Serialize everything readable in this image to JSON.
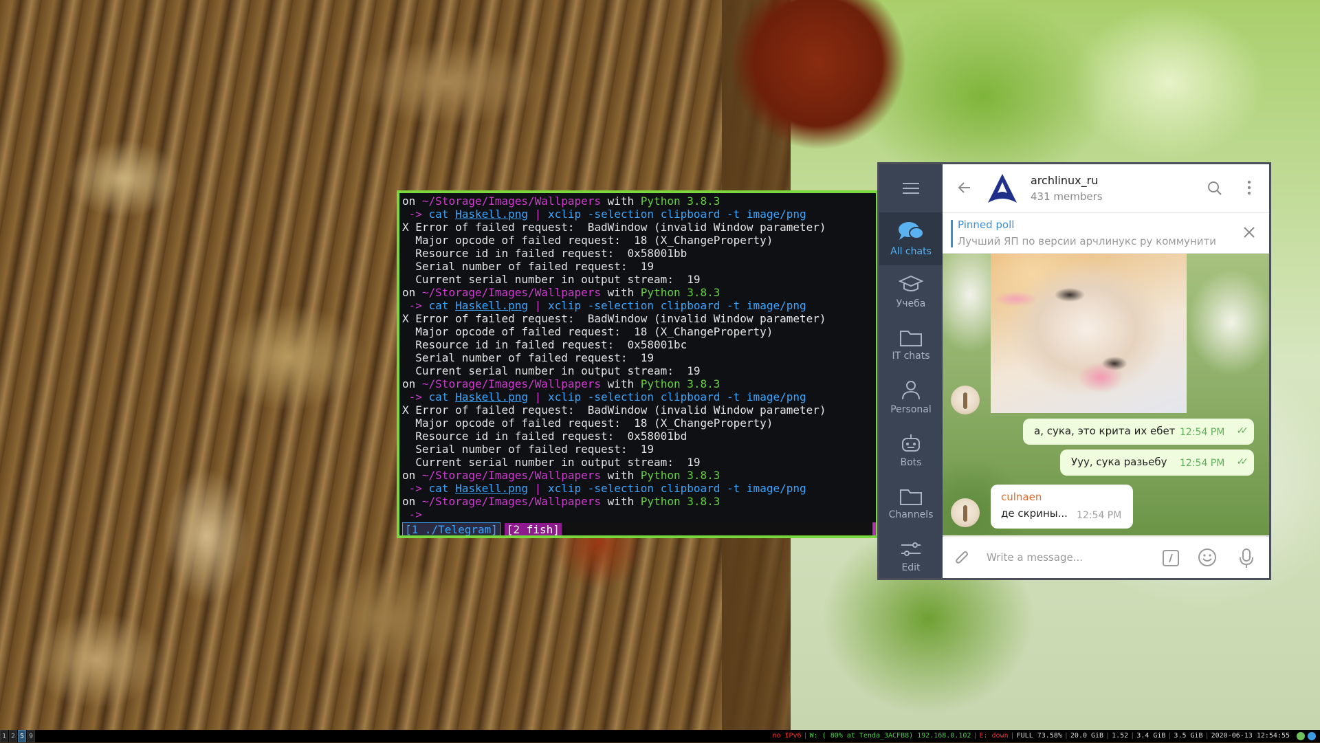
{
  "terminal": {
    "lines": [
      [
        {
          "t": "on ",
          "c": ""
        },
        {
          "t": "~/Storage/Images/Wallpapers",
          "c": "c-path"
        },
        {
          "t": " with ",
          "c": ""
        },
        {
          "t": "Python 3.8.3",
          "c": "c-py"
        }
      ],
      [
        {
          "t": " -> ",
          "c": "c-arrow"
        },
        {
          "t": "cat ",
          "c": "c-cmd"
        },
        {
          "t": "Haskell.png",
          "c": "c-file"
        },
        {
          "t": " | ",
          "c": "c-pipe"
        },
        {
          "t": "xclip -selection clipboard -t image/png",
          "c": "c-cmd"
        }
      ],
      [
        {
          "t": "X Error of failed request:  BadWindow (invalid Window parameter)",
          "c": ""
        }
      ],
      [
        {
          "t": "  Major opcode of failed request:  18 (X_ChangeProperty)",
          "c": ""
        }
      ],
      [
        {
          "t": "  Resource id in failed request:  0x58001bb",
          "c": ""
        }
      ],
      [
        {
          "t": "  Serial number of failed request:  19",
          "c": ""
        }
      ],
      [
        {
          "t": "  Current serial number in output stream:  19",
          "c": ""
        }
      ],
      [
        {
          "t": "on ",
          "c": ""
        },
        {
          "t": "~/Storage/Images/Wallpapers",
          "c": "c-path"
        },
        {
          "t": " with ",
          "c": ""
        },
        {
          "t": "Python 3.8.3",
          "c": "c-py"
        }
      ],
      [
        {
          "t": " -> ",
          "c": "c-arrow"
        },
        {
          "t": "cat ",
          "c": "c-cmd"
        },
        {
          "t": "Haskell.png",
          "c": "c-file"
        },
        {
          "t": " | ",
          "c": "c-pipe"
        },
        {
          "t": "xclip -selection clipboard -t image/png",
          "c": "c-cmd"
        }
      ],
      [
        {
          "t": "X Error of failed request:  BadWindow (invalid Window parameter)",
          "c": ""
        }
      ],
      [
        {
          "t": "  Major opcode of failed request:  18 (X_ChangeProperty)",
          "c": ""
        }
      ],
      [
        {
          "t": "  Resource id in failed request:  0x58001bc",
          "c": ""
        }
      ],
      [
        {
          "t": "  Serial number of failed request:  19",
          "c": ""
        }
      ],
      [
        {
          "t": "  Current serial number in output stream:  19",
          "c": ""
        }
      ],
      [
        {
          "t": "on ",
          "c": ""
        },
        {
          "t": "~/Storage/Images/Wallpapers",
          "c": "c-path"
        },
        {
          "t": " with ",
          "c": ""
        },
        {
          "t": "Python 3.8.3",
          "c": "c-py"
        }
      ],
      [
        {
          "t": " -> ",
          "c": "c-arrow"
        },
        {
          "t": "cat ",
          "c": "c-cmd"
        },
        {
          "t": "Haskell.png",
          "c": "c-file"
        },
        {
          "t": " | ",
          "c": "c-pipe"
        },
        {
          "t": "xclip -selection clipboard -t image/png",
          "c": "c-cmd"
        }
      ],
      [
        {
          "t": "X Error of failed request:  BadWindow (invalid Window parameter)",
          "c": ""
        }
      ],
      [
        {
          "t": "  Major opcode of failed request:  18 (X_ChangeProperty)",
          "c": ""
        }
      ],
      [
        {
          "t": "  Resource id in failed request:  0x58001bd",
          "c": ""
        }
      ],
      [
        {
          "t": "  Serial number of failed request:  19",
          "c": ""
        }
      ],
      [
        {
          "t": "  Current serial number in output stream:  19",
          "c": ""
        }
      ],
      [
        {
          "t": "on ",
          "c": ""
        },
        {
          "t": "~/Storage/Images/Wallpapers",
          "c": "c-path"
        },
        {
          "t": " with ",
          "c": ""
        },
        {
          "t": "Python 3.8.3",
          "c": "c-py"
        }
      ],
      [
        {
          "t": " -> ",
          "c": "c-arrow"
        },
        {
          "t": "cat ",
          "c": "c-cmd"
        },
        {
          "t": "Haskell.png",
          "c": "c-file"
        },
        {
          "t": " | ",
          "c": "c-pipe"
        },
        {
          "t": "xclip -selection clipboard -t image/png",
          "c": "c-cmd"
        }
      ],
      [
        {
          "t": "on ",
          "c": ""
        },
        {
          "t": "~/Storage/Images/Wallpapers",
          "c": "c-path"
        },
        {
          "t": " with ",
          "c": ""
        },
        {
          "t": "Python 3.8.3",
          "c": "c-py"
        }
      ],
      [
        {
          "t": " ->",
          "c": "c-arrow"
        }
      ]
    ],
    "tabs": [
      "[1 ./Telegram]",
      "[2 fish]"
    ]
  },
  "telegram": {
    "folders": [
      {
        "label": "All chats",
        "icon": "chat-bubbles-icon",
        "active": true
      },
      {
        "label": "Учеба",
        "icon": "graduation-cap-icon",
        "active": false
      },
      {
        "label": "IT chats",
        "icon": "folder-icon",
        "active": false
      },
      {
        "label": "Personal",
        "icon": "person-icon",
        "active": false
      },
      {
        "label": "Bots",
        "icon": "robot-icon",
        "active": false
      },
      {
        "label": "Channels",
        "icon": "folder-icon",
        "active": false
      },
      {
        "label": "Edit",
        "icon": "sliders-icon",
        "active": false
      }
    ],
    "header": {
      "title": "archlinux_ru",
      "subtitle": "431 members"
    },
    "pinned": {
      "label": "Pinned poll",
      "text": "Лучший ЯП по версии арчлинукс ру коммунити"
    },
    "messages": [
      {
        "text": "а, сука, это крита их ебет",
        "time": "12:54 PM",
        "outgoing": true
      },
      {
        "text": "Ууу, сука разьебу",
        "time": "12:54 PM",
        "outgoing": true
      },
      {
        "sender": "culnaen",
        "text": "де скрины...",
        "time": "12:54 PM",
        "outgoing": false
      }
    ],
    "input": {
      "placeholder": "Write a message..."
    },
    "accent": "#3a90d0"
  },
  "statusbar": {
    "workspaces": [
      {
        "n": "1",
        "active": false
      },
      {
        "n": "2",
        "active": false
      },
      {
        "n": "5",
        "active": true
      },
      {
        "n": "9",
        "active": false
      }
    ],
    "blocks": [
      {
        "t": "no IPv6",
        "c": "st-red"
      },
      {
        "t": "W: ( 80% at Tenda_3ACFB8) 192.168.0.102",
        "c": "st-green"
      },
      {
        "t": "E: down",
        "c": "st-red"
      },
      {
        "t": "FULL 73.58%",
        "c": ""
      },
      {
        "t": "20.0 GiB",
        "c": ""
      },
      {
        "t": "1.52",
        "c": ""
      },
      {
        "t": "3.4 GiB",
        "c": ""
      },
      {
        "t": "3.5 GiB",
        "c": ""
      },
      {
        "t": "2020-06-13 12:54:55",
        "c": ""
      }
    ]
  }
}
